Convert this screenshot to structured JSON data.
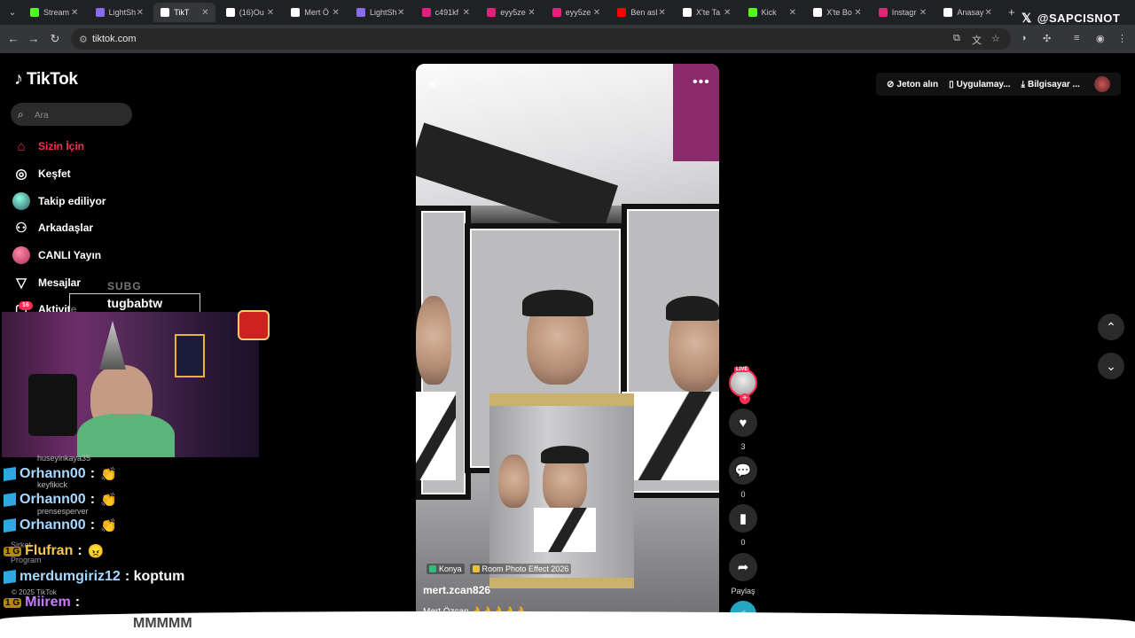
{
  "browser": {
    "tabs": [
      {
        "title": "Stream",
        "fav": "#53fc18",
        "active": false
      },
      {
        "title": "LightSh",
        "fav": "#8a6cf0",
        "active": false
      },
      {
        "title": "TikT",
        "fav": "#ffffff",
        "active": true
      },
      {
        "title": "(16)Ou",
        "fav": "#ffffff",
        "active": false
      },
      {
        "title": "Mert Ö",
        "fav": "#ffffff",
        "active": false
      },
      {
        "title": "LightSh",
        "fav": "#8a6cf0",
        "active": false
      },
      {
        "title": "c491kf",
        "fav": "#e0217d",
        "active": false
      },
      {
        "title": "eyy5ze",
        "fav": "#e0217d",
        "active": false
      },
      {
        "title": "eyy5ze",
        "fav": "#e0217d",
        "active": false
      },
      {
        "title": "Ben asl",
        "fav": "#ff0000",
        "active": false
      },
      {
        "title": "X'te Ta",
        "fav": "#ffffff",
        "active": false
      },
      {
        "title": "Kick",
        "fav": "#53fc18",
        "active": false
      },
      {
        "title": "X'te Bo",
        "fav": "#ffffff",
        "active": false
      },
      {
        "title": "Instagr",
        "fav": "#d62976",
        "active": false
      },
      {
        "title": "Anasay",
        "fav": "#ffffff",
        "active": false
      }
    ],
    "new_tab": "+",
    "url": "tiktok.com",
    "watermark": "@SAPCISNOT",
    "watermark_x": "𝕏"
  },
  "sidebar": {
    "logo": "TikTok",
    "search_placeholder": "Ara",
    "items": [
      {
        "label": "Sizin İçin",
        "icon": "home-icon",
        "glyph": "⌂"
      },
      {
        "label": "Keşfet",
        "icon": "compass-icon",
        "glyph": "◎"
      },
      {
        "label": "Takip ediliyor",
        "icon": "following-avatar-icon",
        "glyph": ""
      },
      {
        "label": "Arkadaşlar",
        "icon": "friends-icon",
        "glyph": "⚇"
      },
      {
        "label": "CANLI Yayın",
        "icon": "live-icon",
        "glyph": ""
      },
      {
        "label": "Mesajlar",
        "icon": "messages-icon",
        "glyph": "▽"
      },
      {
        "label": "Aktivite",
        "icon": "activity-icon",
        "glyph": "▢"
      }
    ],
    "activity_badge": "16",
    "ghost_program": "Program",
    "ghost_sirket": "Şirket",
    "copyright": "© 2025 TikTok"
  },
  "stream_overlay": {
    "sub_label": "SUBG",
    "streamer_name": "tugbabtw",
    "chat": [
      {
        "user": "Orhann00",
        "msg": ":",
        "emoji": "👏",
        "color": "#a8d8ff",
        "kind": "cube"
      },
      {
        "user": "Orhann00",
        "msg": ":",
        "emoji": "👏",
        "color": "#a8d8ff",
        "kind": "cube"
      },
      {
        "user": "Orhann00",
        "msg": ":",
        "emoji": "👏",
        "color": "#a8d8ff",
        "kind": "cube"
      },
      {
        "user": "Flufran",
        "msg": ":",
        "emoji": "😠",
        "color": "#f5c84a",
        "kind": "badge",
        "badges": "1 G"
      },
      {
        "user": "merdumgiriz12",
        "msg": ": koptum",
        "emoji": "",
        "color": "#a8d8ff",
        "kind": "cube"
      },
      {
        "user": "Miirem",
        "msg": ":",
        "emoji": "",
        "color": "#c77dff",
        "kind": "badge",
        "badges": "1 G"
      }
    ],
    "ghost_users": [
      "huseyinkaya35",
      "keyfikick",
      "prensesperver"
    ],
    "chat_tail": "MMMMM"
  },
  "video": {
    "location_tag": "Konya",
    "effect_tag": "Room Photo Effect 2026",
    "author": "mert.zcan826",
    "caption": "Mert Özcan 👌👌👌👌👌"
  },
  "actions": {
    "live_label": "LIVE",
    "likes": "3",
    "comments": "0",
    "saves": "0",
    "share_label": "Paylaş",
    "music_label": "♫"
  },
  "header_links": {
    "coins": "Jeton alın",
    "app": "Uygulamay...",
    "desktop": "Bilgisayar ..."
  }
}
